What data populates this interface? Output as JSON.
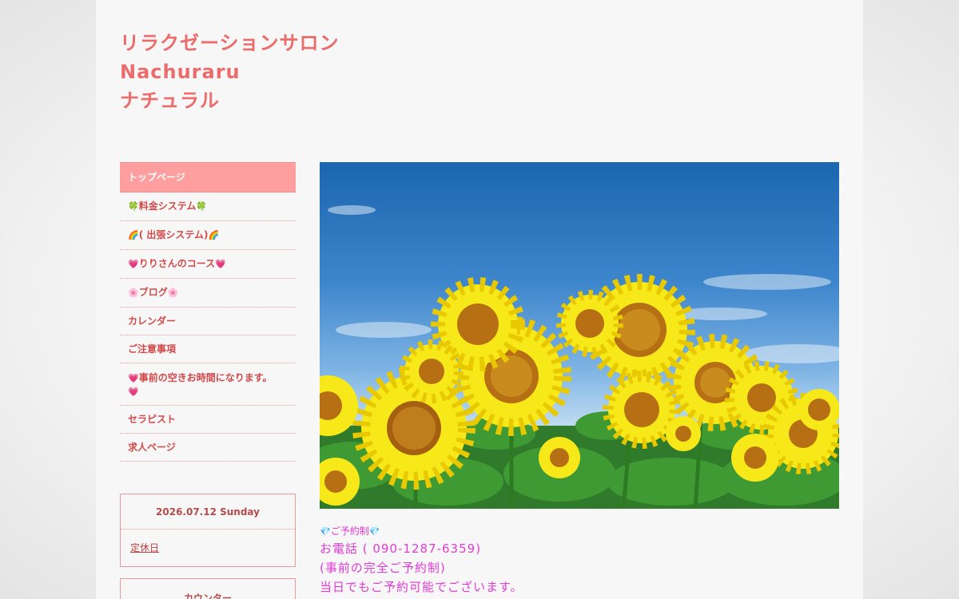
{
  "site": {
    "title_lines": [
      "リラクゼーションサロン",
      "Nachuraru",
      "ナチュラル"
    ]
  },
  "nav": {
    "items": [
      {
        "label": "トップページ"
      },
      {
        "pre": "🍀",
        "label": "料金システム",
        "post": "🍀"
      },
      {
        "pre": "🌈",
        "label": "( 出張システム)",
        "post": "🌈"
      },
      {
        "pre": "💗",
        "label": "りりさんのコース",
        "post": "💗"
      },
      {
        "pre": "🌸",
        "label": "ブログ",
        "post": "🌸"
      },
      {
        "label": "カレンダー"
      },
      {
        "label": "ご注意事項"
      },
      {
        "pre": "💗",
        "label": "事前の空きお時間になります。",
        "post": "💗"
      },
      {
        "label": "セラピスト"
      },
      {
        "label": "求人ページ"
      }
    ]
  },
  "calendar_widget": {
    "date": "2026.07.12 Sunday",
    "link": "定休日"
  },
  "counter_widget": {
    "title": "カウンター"
  },
  "hero": {
    "icon": "sunflower-field-image"
  },
  "main": {
    "reserve_pre": "💎",
    "reserve": "ご予約制",
    "reserve_post": "💎",
    "phone": "お電話 ( 090-1287-6359)",
    "note1": "(事前の完全ご予約制)",
    "note2": "当日でもご予約可能でございます。"
  },
  "colors": {
    "accent": "#ec6b6b",
    "nav_active": "#ff9e9e",
    "content_text": "#e23cd7"
  }
}
